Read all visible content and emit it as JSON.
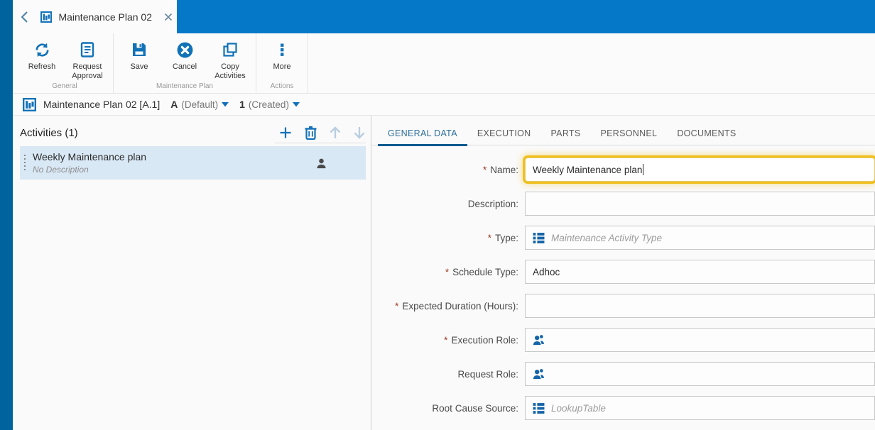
{
  "colors": {
    "header_blue": "#0578c8",
    "rail_blue": "#00639d",
    "icon_blue": "#1272b8",
    "accent_blue": "#1470b8",
    "selection_blue": "#d9e8f5",
    "focus_yellow": "#efc01e",
    "tab_active_blue": "#2d6f9e",
    "required_red": "#9a3b24"
  },
  "window": {
    "tab_title": "Maintenance Plan 02"
  },
  "toolbar": {
    "groups": [
      {
        "label": "General",
        "buttons": [
          {
            "label": "Refresh",
            "icon": "refresh-icon"
          },
          {
            "label": "Request Approval",
            "icon": "request-approval-icon"
          }
        ]
      },
      {
        "label": "Maintenance Plan",
        "buttons": [
          {
            "label": "Save",
            "icon": "save-icon"
          },
          {
            "label": "Cancel",
            "icon": "cancel-icon"
          },
          {
            "label": "Copy Activities",
            "icon": "copy-icon"
          }
        ]
      },
      {
        "label": "Actions",
        "buttons": [
          {
            "label": "More",
            "icon": "more-icon"
          }
        ]
      }
    ]
  },
  "breadcrumb": {
    "title": "Maintenance Plan 02 [A.1]",
    "version": "A",
    "version_status": "(Default)",
    "revision": "1",
    "revision_status": "(Created)"
  },
  "activities": {
    "header": "Activities (1)",
    "items": [
      {
        "title": "Weekly Maintenance plan",
        "description": "No Description"
      }
    ]
  },
  "detail": {
    "tabs": [
      {
        "label": "GENERAL DATA",
        "active": true
      },
      {
        "label": "EXECUTION",
        "active": false
      },
      {
        "label": "PARTS",
        "active": false
      },
      {
        "label": "PERSONNEL",
        "active": false
      },
      {
        "label": "DOCUMENTS",
        "active": false
      }
    ],
    "form": {
      "required_mark": "*",
      "fields": [
        {
          "label": "Name:",
          "required": true,
          "value": "Weekly Maintenance plan",
          "focused": true
        },
        {
          "label": "Description:",
          "required": false,
          "value": ""
        },
        {
          "label": "Type:",
          "required": true,
          "value": "",
          "placeholder": "Maintenance Activity Type",
          "icon": "list-icon"
        },
        {
          "label": "Schedule Type:",
          "required": true,
          "value": "Adhoc"
        },
        {
          "label": "Expected Duration (Hours):",
          "required": true,
          "value": ""
        },
        {
          "label": "Execution Role:",
          "required": true,
          "value": "",
          "icon": "people-icon"
        },
        {
          "label": "Request Role:",
          "required": false,
          "value": "",
          "icon": "people-icon"
        },
        {
          "label": "Root Cause Source:",
          "required": false,
          "value": "",
          "placeholder": "LookupTable",
          "icon": "list-icon"
        }
      ]
    }
  }
}
